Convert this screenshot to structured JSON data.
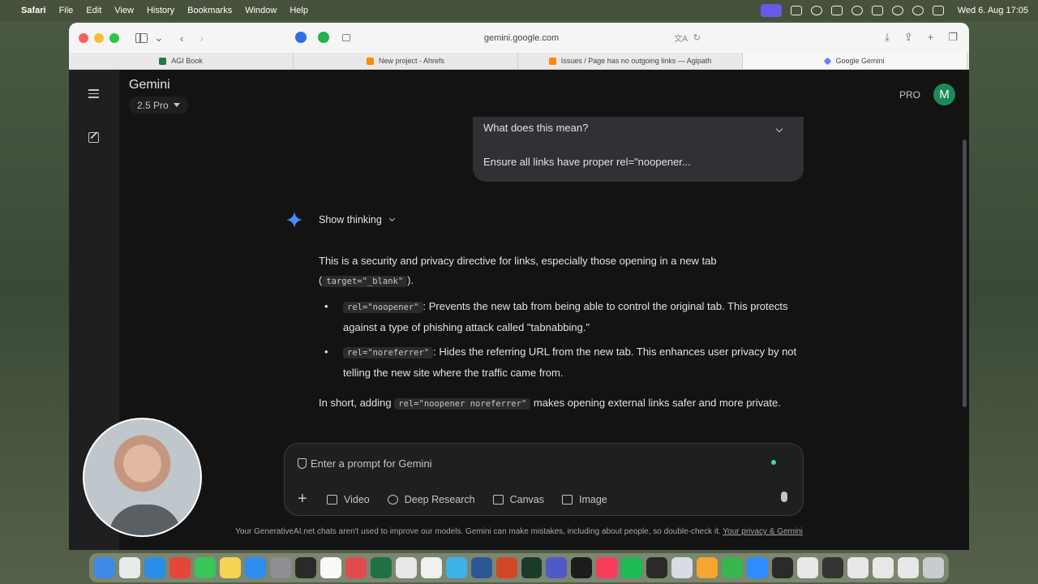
{
  "menubar": {
    "app": "Safari",
    "items": [
      "File",
      "Edit",
      "View",
      "History",
      "Bookmarks",
      "Window",
      "Help"
    ],
    "datetime": "Wed 6. Aug  17:05"
  },
  "browser": {
    "url": "gemini.google.com",
    "tabs": [
      {
        "title": "AGI Book"
      },
      {
        "title": "New project - Ahrefs"
      },
      {
        "title": "Issues / Page has no outgoing links — Agipath"
      },
      {
        "title": "Google Gemini"
      }
    ]
  },
  "app": {
    "brand": "Gemini",
    "model": "2.5 Pro",
    "pro_badge": "PRO",
    "avatar_initial": "M"
  },
  "user_message": {
    "line1": "What does this mean?",
    "line2": "Ensure all links have proper rel=\"noopener..."
  },
  "response": {
    "show_thinking": "Show thinking",
    "intro_a": "This is a security and privacy directive for links, especially those opening in a new tab (",
    "intro_code": "target=\"_blank\"",
    "intro_b": ").",
    "bullets": [
      {
        "code": "rel=\"noopener\"",
        "text": ": Prevents the new tab from being able to control the original tab. This protects against a type of phishing attack called \"tabnabbing.\""
      },
      {
        "code": "rel=\"noreferrer\"",
        "text": ": Hides the referring URL from the new tab. This enhances user privacy by not telling the new site where the traffic came from."
      }
    ],
    "summary_a": "In short, adding ",
    "summary_code": "rel=\"noopener noreferrer\"",
    "summary_b": " makes opening external links safer and more private."
  },
  "prompt": {
    "placeholder": "Enter a prompt for Gemini",
    "tools": [
      "Video",
      "Deep Research",
      "Canvas",
      "Image"
    ]
  },
  "disclaimer": {
    "text": "Your GenerativeAI.net chats aren't used to improve our models. Gemini can make mistakes, including about people, so double-check it. ",
    "link": "Your privacy & Gemini"
  },
  "colors": {
    "background": "#131314",
    "accent": "#1b8a5a",
    "sparkle": "#4a8cff"
  }
}
